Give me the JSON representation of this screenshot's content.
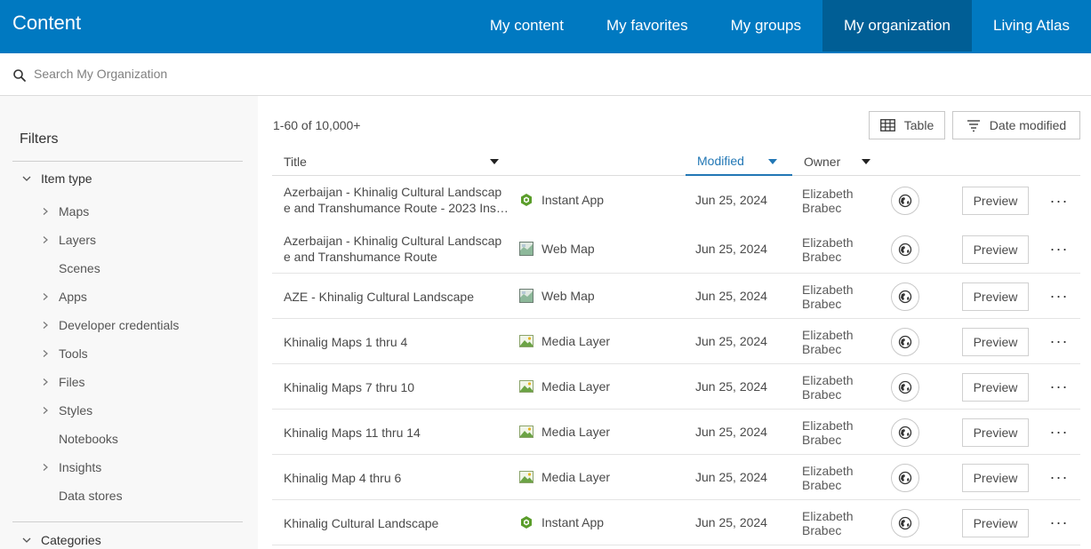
{
  "header": {
    "app_title": "Content",
    "tabs": [
      {
        "label": "My content"
      },
      {
        "label": "My favorites"
      },
      {
        "label": "My groups"
      },
      {
        "label": "My organization"
      },
      {
        "label": "Living Atlas"
      }
    ],
    "active_tab": "My organization",
    "bar_color": "#0079c1",
    "active_tab_color": "#005e95"
  },
  "search": {
    "placeholder": "Search My Organization",
    "value": ""
  },
  "sidebar": {
    "title": "Filters",
    "item_type": {
      "label": "Item type",
      "items": [
        {
          "label": "Maps",
          "expandable": true
        },
        {
          "label": "Layers",
          "expandable": true
        },
        {
          "label": "Scenes",
          "expandable": false
        },
        {
          "label": "Apps",
          "expandable": true
        },
        {
          "label": "Developer credentials",
          "expandable": true
        },
        {
          "label": "Tools",
          "expandable": true
        },
        {
          "label": "Files",
          "expandable": true
        },
        {
          "label": "Styles",
          "expandable": true
        },
        {
          "label": "Notebooks",
          "expandable": false
        },
        {
          "label": "Insights",
          "expandable": true
        },
        {
          "label": "Data stores",
          "expandable": false
        }
      ]
    },
    "categories": {
      "label": "Categories"
    }
  },
  "toolbar": {
    "count": "1-60 of 10,000+",
    "view_label": "Table",
    "sort_label": "Date modified"
  },
  "table": {
    "columns": {
      "title": "Title",
      "modified": "Modified",
      "owner": "Owner"
    },
    "sort_color": "#2277b5",
    "preview_label": "Preview",
    "more_label": "···",
    "rows": [
      {
        "title": "Azerbaijan - Khinalig Cultural Landscap",
        "title2": "e and Transhumance Route - 2023 Ins…",
        "type": "Instant App",
        "type_icon": "instant-app-icon",
        "modified": "Jun 25, 2024",
        "owner1": "Elizabeth",
        "owner2": "Brabec"
      },
      {
        "title": "Azerbaijan - Khinalig Cultural Landscap",
        "title2": "e and Transhumance Route",
        "type": "Web Map",
        "type_icon": "web-map-icon",
        "modified": "Jun 25, 2024",
        "owner1": "Elizabeth",
        "owner2": "Brabec"
      },
      {
        "title": "AZE - Khinalig Cultural Landscape",
        "title2": "",
        "type": "Web Map",
        "type_icon": "web-map-icon",
        "modified": "Jun 25, 2024",
        "owner1": "Elizabeth",
        "owner2": "Brabec"
      },
      {
        "title": "Khinalig Maps 1 thru 4",
        "title2": "",
        "type": "Media Layer",
        "type_icon": "media-layer-icon",
        "modified": "Jun 25, 2024",
        "owner1": "Elizabeth",
        "owner2": "Brabec"
      },
      {
        "title": "Khinalig Maps 7 thru 10",
        "title2": "",
        "type": "Media Layer",
        "type_icon": "media-layer-icon",
        "modified": "Jun 25, 2024",
        "owner1": "Elizabeth",
        "owner2": "Brabec"
      },
      {
        "title": "Khinalig Maps 11 thru 14",
        "title2": "",
        "type": "Media Layer",
        "type_icon": "media-layer-icon",
        "modified": "Jun 25, 2024",
        "owner1": "Elizabeth",
        "owner2": "Brabec"
      },
      {
        "title": "Khinalig Map 4 thru 6",
        "title2": "",
        "type": "Media Layer",
        "type_icon": "media-layer-icon",
        "modified": "Jun 25, 2024",
        "owner1": "Elizabeth",
        "owner2": "Brabec"
      },
      {
        "title": "Khinalig Cultural Landscape",
        "title2": "",
        "type": "Instant App",
        "type_icon": "instant-app-icon",
        "modified": "Jun 25, 2024",
        "owner1": "Elizabeth",
        "owner2": "Brabec"
      }
    ]
  }
}
